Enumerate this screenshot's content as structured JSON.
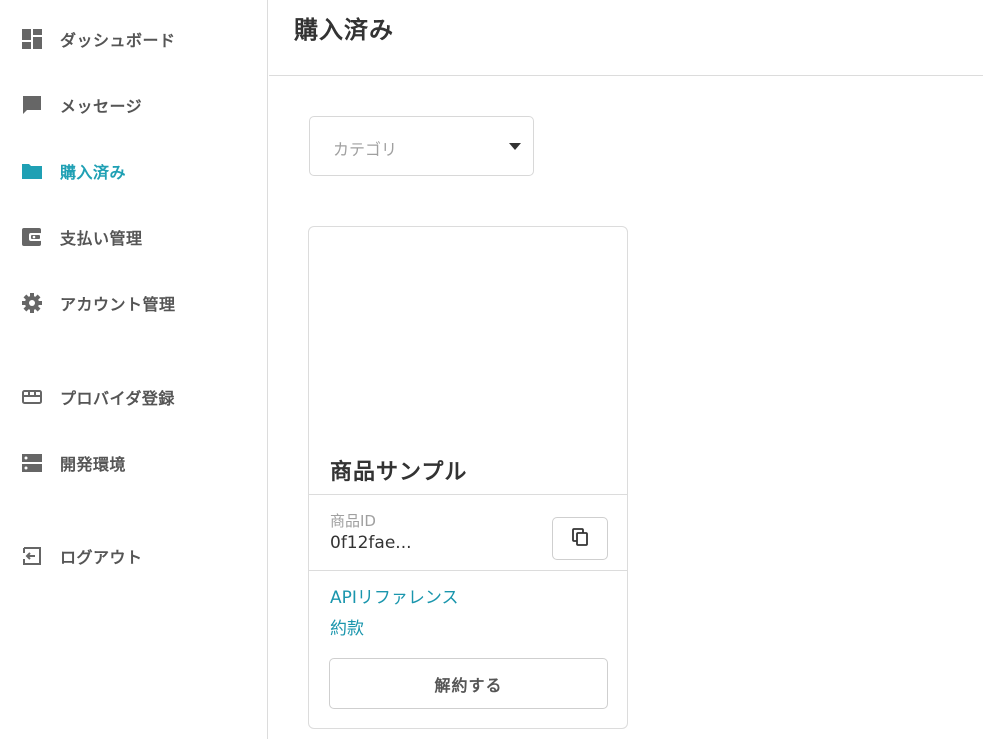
{
  "sidebar": {
    "items": [
      {
        "label": "ダッシュボード",
        "icon": "dashboard-icon",
        "active": false
      },
      {
        "label": "メッセージ",
        "icon": "message-icon",
        "active": false
      },
      {
        "label": "購入済み",
        "icon": "folder-icon",
        "active": true
      },
      {
        "label": "支払い管理",
        "icon": "wallet-icon",
        "active": false
      },
      {
        "label": "アカウント管理",
        "icon": "gear-icon",
        "active": false
      },
      {
        "label": "プロバイダ登録",
        "icon": "store-icon",
        "active": false
      },
      {
        "label": "開発環境",
        "icon": "server-icon",
        "active": false
      },
      {
        "label": "ログアウト",
        "icon": "logout-icon",
        "active": false
      }
    ]
  },
  "header": {
    "title": "購入済み"
  },
  "filter": {
    "category_placeholder": "カテゴリ"
  },
  "product": {
    "name": "商品サンプル",
    "id_label": "商品ID",
    "id_value": "0f12fae...",
    "links": [
      "APIリファレンス",
      "約款"
    ],
    "cancel_label": "解約する"
  },
  "colors": {
    "accent": "#1fa0b4",
    "link": "#1a96ad",
    "icon": "#666666",
    "text": "#333333",
    "muted": "#a0a0a0",
    "border": "#dcdcdc"
  }
}
